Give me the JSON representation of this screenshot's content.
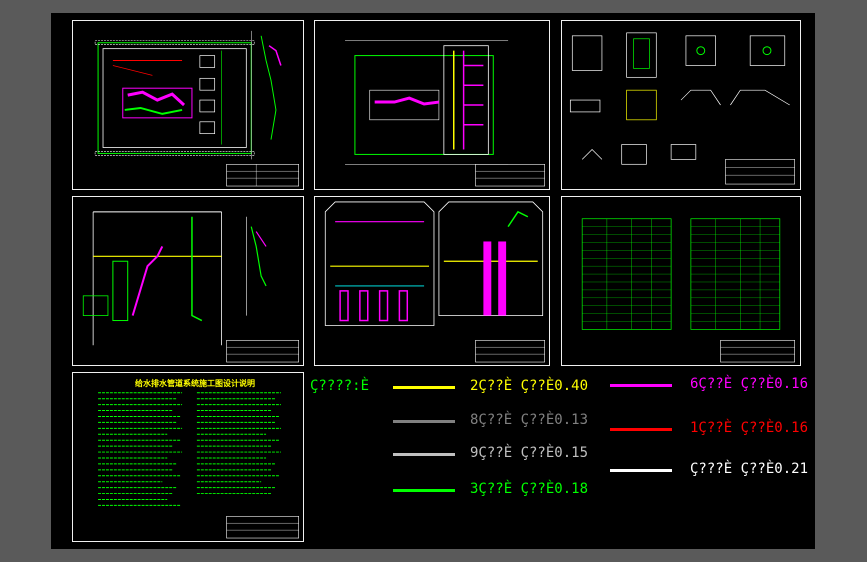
{
  "notes": {
    "title": "给水排水管道系统施工图设计说明"
  },
  "legend": {
    "header": "Ç????:È",
    "items": [
      {
        "label": "2Ç??È  Ç??È0.40",
        "color": "#ffff00"
      },
      {
        "label": "8Ç??È  Ç??È0.13",
        "color": "#808080"
      },
      {
        "label": "9Ç??È  Ç??È0.15",
        "color": "#c0c0c0"
      },
      {
        "label": "3Ç??È  Ç??È0.18",
        "color": "#00ff00"
      },
      {
        "label": "6Ç??È  Ç??È0.16",
        "color": "#ff00ff"
      },
      {
        "label": "1Ç??È  Ç??È0.16",
        "color": "#ff0000"
      },
      {
        "label": "Ç???È  Ç??È0.21",
        "color": "#ffffff"
      }
    ]
  },
  "colors": {
    "green": "#00ff00",
    "magenta": "#ff00ff",
    "yellow": "#ffff00",
    "red": "#ff0000",
    "white": "#ffffff",
    "cyan": "#00ffff"
  }
}
